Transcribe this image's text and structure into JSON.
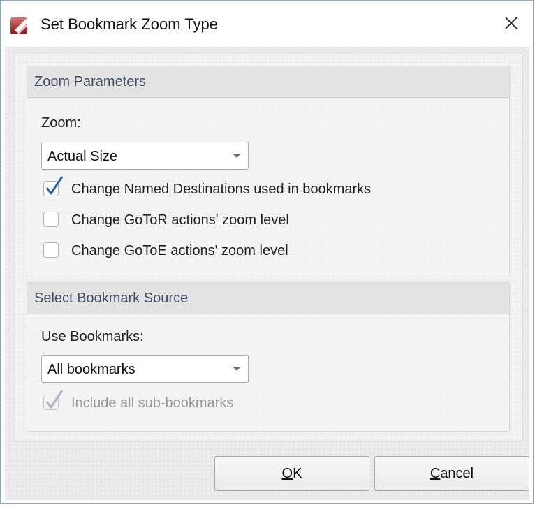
{
  "window": {
    "title": "Set Bookmark Zoom Type",
    "close_glyph": "✕",
    "icon": "pdf-app-icon"
  },
  "zoom_parameters": {
    "title": "Zoom Parameters",
    "zoom_label": "Zoom:",
    "zoom_value": "Actual Size",
    "options": [
      {
        "label": "Change Named Destinations used in bookmarks",
        "checked": true,
        "enabled": true
      },
      {
        "label": "Change GoToR actions' zoom level",
        "checked": false,
        "enabled": true
      },
      {
        "label": "Change GoToE actions' zoom level",
        "checked": false,
        "enabled": true
      }
    ]
  },
  "bookmark_source": {
    "title": "Select Bookmark Source",
    "use_label": "Use Bookmarks:",
    "use_value": "All bookmarks",
    "include_sub": {
      "label": "Include all sub-bookmarks",
      "checked": true,
      "enabled": false
    }
  },
  "buttons": {
    "ok_mnemonic": "O",
    "ok_rest": "K",
    "cancel_mnemonic": "C",
    "cancel_rest": "ancel"
  },
  "colors": {
    "accent_red": "#d32f2f",
    "check_blue": "#2a5ca8",
    "group_title": "#3f4f66"
  }
}
